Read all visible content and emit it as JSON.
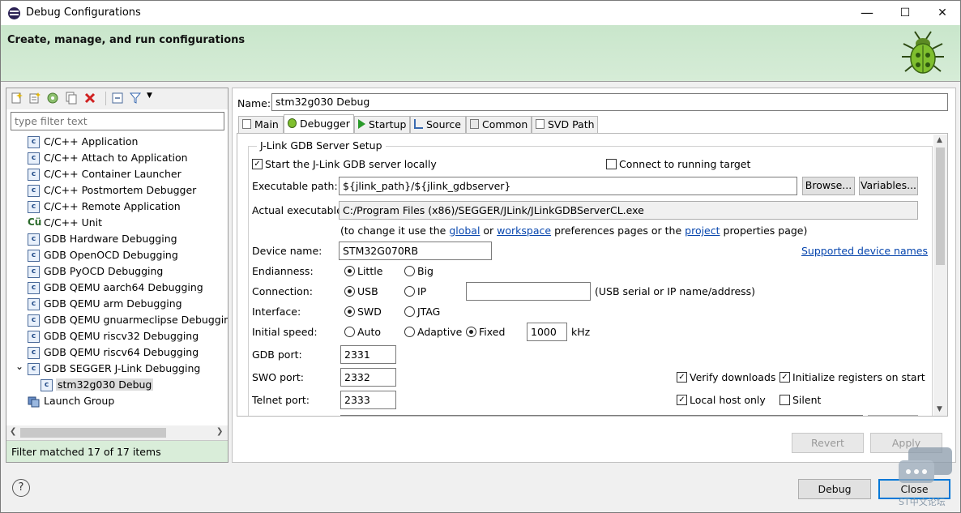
{
  "window": {
    "title": "Debug Configurations",
    "minimize": "—",
    "maximize": "☐",
    "close": "✕"
  },
  "banner": {
    "title": "Create, manage, and run configurations"
  },
  "left": {
    "filter_placeholder": "type filter text",
    "items": [
      {
        "label": "C/C++ Application",
        "icon": "c-icon"
      },
      {
        "label": "C/C++ Attach to Application",
        "icon": "c-icon"
      },
      {
        "label": "C/C++ Container Launcher",
        "icon": "c-icon"
      },
      {
        "label": "C/C++ Postmortem Debugger",
        "icon": "c-icon"
      },
      {
        "label": "C/C++ Remote Application",
        "icon": "c-icon"
      },
      {
        "label": "C/C++ Unit",
        "icon": "c-unit-icon"
      },
      {
        "label": "GDB Hardware Debugging",
        "icon": "c-icon"
      },
      {
        "label": "GDB OpenOCD Debugging",
        "icon": "c-icon"
      },
      {
        "label": "GDB PyOCD Debugging",
        "icon": "c-icon"
      },
      {
        "label": "GDB QEMU aarch64 Debugging",
        "icon": "c-icon"
      },
      {
        "label": "GDB QEMU arm Debugging",
        "icon": "c-icon"
      },
      {
        "label": "GDB QEMU gnuarmeclipse Debugging",
        "icon": "c-icon"
      },
      {
        "label": "GDB QEMU riscv32 Debugging",
        "icon": "c-icon"
      },
      {
        "label": "GDB QEMU riscv64 Debugging",
        "icon": "c-icon"
      },
      {
        "label": "GDB SEGGER J-Link Debugging",
        "icon": "c-icon",
        "expanded": "⌄"
      },
      {
        "label": "stm32g030 Debug",
        "icon": "c-icon",
        "selected": "true"
      },
      {
        "label": "Launch Group",
        "icon": "launch-group-icon"
      }
    ],
    "status": "Filter matched 17 of 17 items"
  },
  "right": {
    "name_label": "Name:",
    "name_value": "stm32g030 Debug",
    "tabs": [
      "Main",
      "Debugger",
      "Startup",
      "Source",
      "Common",
      "SVD Path"
    ],
    "active_tab": "Debugger",
    "group_title": "J-Link GDB Server Setup",
    "start_locally": {
      "label": "Start the J-Link GDB server locally",
      "checked": true
    },
    "connect_running": {
      "label": "Connect to running target",
      "checked": false
    },
    "exec_label": "Executable path:",
    "exec_value": "${jlink_path}/${jlink_gdbserver}",
    "browse": "Browse...",
    "variables": "Variables...",
    "actual_label": "Actual executable:",
    "actual_value": "C:/Program Files (x86)/SEGGER/JLink/JLinkGDBServerCL.exe",
    "hint": {
      "pre": "(to change it use the ",
      "global": "global",
      "or": " or ",
      "workspace": "workspace",
      "mid": " preferences pages or the ",
      "project": "project",
      "post": " properties page)"
    },
    "device_label": "Device name:",
    "device_value": "STM32G070RB",
    "supported_link": "Supported device names",
    "endianness_label": "Endianness:",
    "little": "Little",
    "big": "Big",
    "connection_label": "Connection:",
    "usb": "USB",
    "ip": "IP",
    "connection_hint": "(USB serial or IP name/address)",
    "interface_label": "Interface:",
    "swd": "SWD",
    "jtag": "JTAG",
    "speed_label": "Initial speed:",
    "auto": "Auto",
    "adaptive": "Adaptive",
    "fixed": "Fixed",
    "speed_value": "1000",
    "khz": "kHz",
    "gdb_port_label": "GDB port:",
    "gdb_port": "2331",
    "swo_port_label": "SWO port:",
    "swo_port": "2332",
    "telnet_port_label": "Telnet port:",
    "telnet_port": "2333",
    "verify": {
      "label": "Verify downloads",
      "checked": true
    },
    "init_regs": {
      "label": "Initialize registers on start",
      "checked": true
    },
    "local_host": {
      "label": "Local host only",
      "checked": true
    },
    "silent": {
      "label": "Silent",
      "checked": false
    },
    "revert": "Revert",
    "apply": "Apply"
  },
  "footer": {
    "help": "?",
    "debug": "Debug",
    "close": "Close"
  },
  "watermark": "ST中文论坛"
}
